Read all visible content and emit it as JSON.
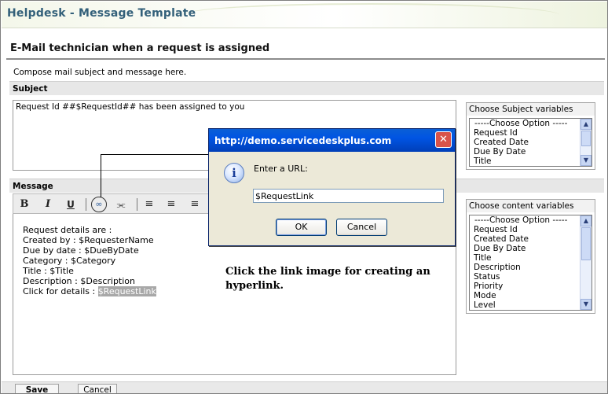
{
  "app": {
    "title": "Helpdesk - Message Template"
  },
  "section": {
    "title": "E-Mail technician when a request is assigned",
    "intro": "Compose mail subject and message here."
  },
  "subject": {
    "label": "Subject",
    "value": "Request Id ##$RequestId## has been assigned to you"
  },
  "message": {
    "label": "Message",
    "toolbar": [
      "B",
      "I",
      "U"
    ],
    "lines": [
      "Request details are :",
      "",
      "Created by : $RequesterName",
      "Due by date : $DueByDate",
      "Category : $Category",
      "Title : $Title",
      "Description : $Description"
    ],
    "link_line_prefix": "Click for details : ",
    "link_text": "$RequestLink"
  },
  "subject_vars": {
    "caption": "Choose Subject variables",
    "options": [
      "-----Choose Option -----",
      "Request Id",
      "Created Date",
      "Due By Date",
      "Title"
    ]
  },
  "content_vars": {
    "caption": "Choose content variables",
    "options": [
      "-----Choose Option -----",
      "Request Id",
      "Created Date",
      "Due By Date",
      "Title",
      "Description",
      "Status",
      "Priority",
      "Mode",
      "Level"
    ]
  },
  "dialog": {
    "title": "http://demo.servicedeskplus.com",
    "prompt": "Enter a URL:",
    "input_value": "$RequestLink",
    "ok_label": "OK",
    "cancel_label": "Cancel"
  },
  "caption_text": "Click the link image for creating an hyperlink.",
  "footer": {
    "save_label": "Save",
    "cancel_label": "Cancel"
  },
  "colors": {
    "title_blue": "#33607a",
    "dialog_title": "#0054e3",
    "close_red": "#d9534a"
  }
}
